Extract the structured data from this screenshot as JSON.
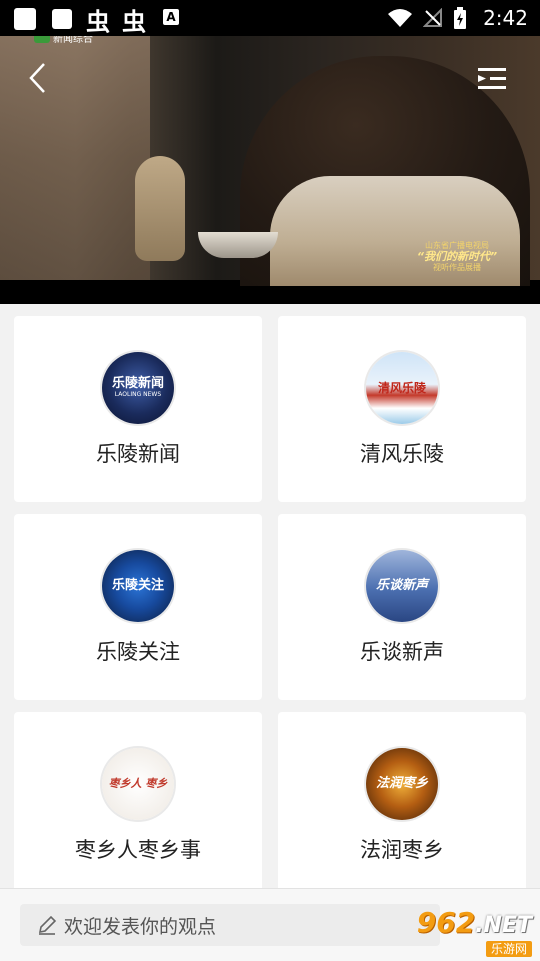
{
  "status_bar": {
    "time": "2:42",
    "glyph_1": "虫",
    "glyph_2": "虫",
    "a_badge": "A"
  },
  "video": {
    "channel_logo": "新闻综合",
    "watermark_line1": "山东省广播电视局",
    "watermark_line2": "“我们的新时代”",
    "watermark_line3": "视听作品展播"
  },
  "cards": [
    {
      "label": "乐陵新闻",
      "icon_text": "乐陵新闻",
      "icon_sub": "LAOLING NEWS",
      "icon": "news-logo-icon"
    },
    {
      "label": "清风乐陵",
      "icon_text": "清风乐陵",
      "icon": "qingfeng-logo-icon"
    },
    {
      "label": "乐陵关注",
      "icon_text": "乐陵关注",
      "icon": "guanzhu-logo-icon"
    },
    {
      "label": "乐谈新声",
      "icon_text": "乐谈新声",
      "icon": "letan-logo-icon"
    },
    {
      "label": "枣乡人枣乡事",
      "icon_text": "枣乡人 枣乡",
      "icon": "zaoxiang-logo-icon"
    },
    {
      "label": "法润枣乡",
      "icon_text": "法润枣乡",
      "icon": "farun-logo-icon"
    }
  ],
  "comment": {
    "placeholder": "欢迎发表你的观点"
  },
  "corner_logo": {
    "num": "962",
    "net": ".NET",
    "site": "乐游网"
  },
  "colors": {
    "accent": "#f39c12",
    "background": "#f2f2f2"
  }
}
